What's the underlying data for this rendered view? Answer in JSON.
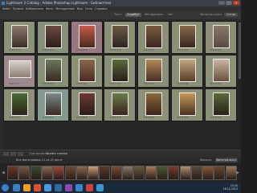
{
  "window": {
    "title": "Lightroom 5 Catalog - Adobe Photoshop Lightroom - Библиотека",
    "controls": [
      "–",
      "□",
      "×"
    ]
  },
  "menu": [
    "Файл",
    "Правка",
    "Библиотека",
    "Фото",
    "Метаданные",
    "Вид",
    "Окно",
    "Справка"
  ],
  "grid_header": {
    "tabs": [
      "Текст",
      "Атрибут",
      "Метаданные",
      "Нет"
    ],
    "active_tab": "Атрибут",
    "right_label": "Фильтры выкл.",
    "right_chip": "Сетка"
  },
  "grid": {
    "cells": [
      {
        "bg": "#8a9278",
        "photo": [
          "#8e7a6b",
          "#3a2c28"
        ],
        "wide": false
      },
      {
        "bg": "#86907a",
        "photo": [
          "#6a4a3e",
          "#2c1f1c"
        ],
        "wide": false
      },
      {
        "bg": "#9a7880",
        "photo": [
          "#c85a4a",
          "#4a2a22"
        ],
        "wide": false
      },
      {
        "bg": "#8b9177",
        "photo": [
          "#6b5a44",
          "#2e2420"
        ],
        "wide": false
      },
      {
        "bg": "#8a8f76",
        "photo": [
          "#7a5a3c",
          "#3a2a22"
        ],
        "wide": false
      },
      {
        "bg": "#8a8f76",
        "photo": [
          "#8a6a4a",
          "#3a2620"
        ],
        "wide": false
      },
      {
        "bg": "#8c8e77",
        "photo": [
          "#8a7a6a",
          "#5a4a44"
        ],
        "wide": false
      },
      {
        "bg": "#9d8a8f",
        "photo": [
          "#d6cfc8",
          "#8e8078"
        ],
        "wide": true
      },
      {
        "bg": "#889077",
        "photo": [
          "#6a7a5a",
          "#3a2a22"
        ],
        "wide": false
      },
      {
        "bg": "#8b9277",
        "photo": [
          "#8a6a4a",
          "#4a2a22"
        ],
        "wide": false
      },
      {
        "bg": "#8a9178",
        "photo": [
          "#5a6a3e",
          "#2a1e18"
        ],
        "wide": false
      },
      {
        "bg": "#8a8f77",
        "photo": [
          "#b08a5a",
          "#4a3022"
        ],
        "wide": false
      },
      {
        "bg": "#8b8f78",
        "photo": [
          "#c2a880",
          "#5a3c2a"
        ],
        "wide": false
      },
      {
        "bg": "#8b9279",
        "photo": [
          "#c8b8a2",
          "#6a5040"
        ],
        "wide": false
      },
      {
        "bg": "#8d8f7b",
        "photo": [
          "#4a6a34",
          "#2e2418"
        ],
        "wide": false
      },
      {
        "bg": "#859a8e",
        "photo": [
          "#7a8a8a",
          "#3a2a24"
        ],
        "wide": false
      },
      {
        "bg": "#8c8f78",
        "photo": [
          "#6a3a32",
          "#2a1c1a"
        ],
        "wide": false
      },
      {
        "bg": "#8c9078",
        "photo": [
          "#6a7a4a",
          "#3a2420"
        ],
        "wide": false
      },
      {
        "bg": "#8c9178",
        "photo": [
          "#8a6a3a",
          "#3a2418"
        ],
        "wide": false
      },
      {
        "bg": "#8b8f78",
        "photo": [
          "#c89a5a",
          "#4a3020"
        ],
        "wide": false
      },
      {
        "bg": "#8b9178",
        "photo": [
          "#5a6a3a",
          "#2a2018"
        ],
        "wide": false
      }
    ]
  },
  "toolbar": {
    "sort_label": "Сортировка:",
    "sort_value": "Время съемки"
  },
  "filmstrip": {
    "source_label": "Все фотографии  21 из 21 фото",
    "filter_label": "Фильтр:",
    "filter_chip": "Фильтры выкл.",
    "thumbs": [
      "#6a3a2e",
      "#7a5a48",
      "#3a4a30",
      "#8a6a52",
      "#a04a3a",
      "#6a4a3a",
      "#8a6a4a",
      "#c8a07a",
      "#5a3a2a",
      "#7a4a3a",
      "#8a7a6a",
      "#6a5a3a",
      "#a87a5a",
      "#4a5a30",
      "#7a3a2e",
      "#b09070",
      "#5a4a3a",
      "#8a5a3a",
      "#6a4a30",
      "#9a7a5a"
    ]
  },
  "taskbar": {
    "time": "15:20",
    "date": "16.12.2013",
    "icon_colors": [
      "#3e7fc1",
      "#f0a020",
      "#e05030",
      "#4a9adf",
      "#2e6aa0",
      "#8a4ab0",
      "#3a86c8",
      "#d04040",
      "#3e96d0"
    ]
  }
}
